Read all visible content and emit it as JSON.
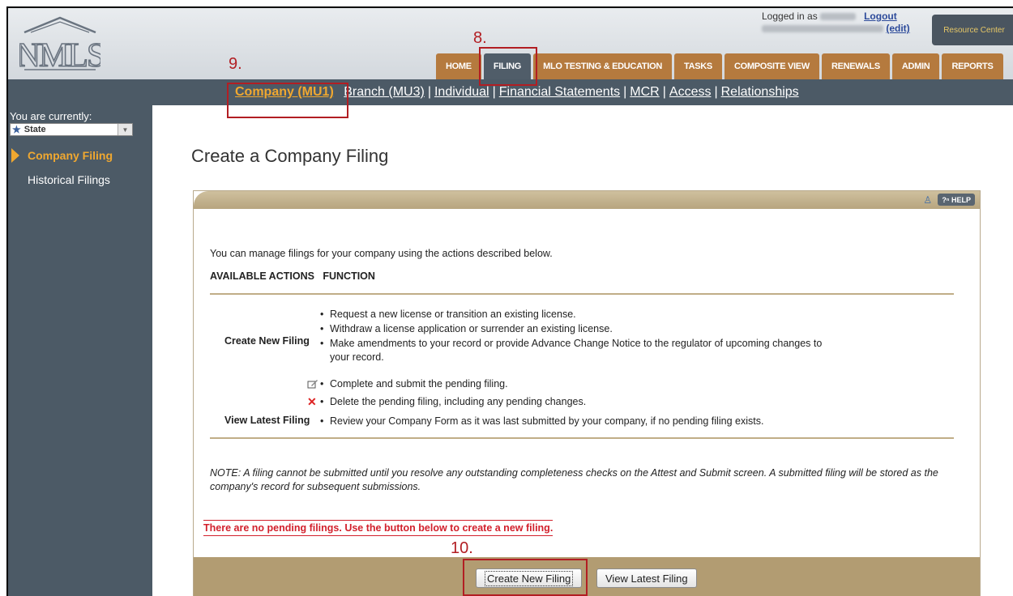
{
  "header": {
    "logo_text": "NMLS",
    "logged_in_label": "Logged in as",
    "logout_label": "Logout",
    "edit_label": "(edit)",
    "resource_center_label": "Resource Center"
  },
  "tabs": [
    {
      "label": "HOME"
    },
    {
      "label": "FILING"
    },
    {
      "label": "MLO TESTING & EDUCATION"
    },
    {
      "label": "TASKS"
    },
    {
      "label": "COMPOSITE VIEW"
    },
    {
      "label": "RENEWALS"
    },
    {
      "label": "ADMIN"
    },
    {
      "label": "REPORTS"
    }
  ],
  "subnav": [
    {
      "label": "Company (MU1)"
    },
    {
      "label": "Branch (MU3)"
    },
    {
      "label": "Individual"
    },
    {
      "label": "Financial Statements"
    },
    {
      "label": "MCR"
    },
    {
      "label": "Access"
    },
    {
      "label": "Relationships"
    }
  ],
  "annotations": {
    "step8": "8.",
    "step9": "9.",
    "step10": "10."
  },
  "sidebar": {
    "context_label": "You are currently:",
    "state_value": "State",
    "items": [
      {
        "label": "Company Filing"
      },
      {
        "label": "Historical Filings"
      }
    ]
  },
  "main": {
    "title": "Create a Company Filing",
    "help_label": "HELP",
    "intro": "You can manage filings for your company using the actions described below.",
    "col_actions": "AVAILABLE ACTIONS",
    "col_function": "FUNCTION",
    "create_label": "Create New Filing",
    "create_bullets": [
      "Request a new license or transition an existing license.",
      "Withdraw a license application or surrender an existing license.",
      "Make amendments to your record or provide Advance Change Notice to the regulator of upcoming changes to"
    ],
    "create_bullet_cont": "your record.",
    "edit_bullet": "Complete and submit the pending filing.",
    "delete_bullet": "Delete the pending filing, including any pending changes.",
    "view_label": "View Latest Filing",
    "view_bullet": "Review your Company Form as it was last submitted by your company, if no pending filing exists.",
    "note": "NOTE: A filing cannot be submitted until you resolve any outstanding completeness checks on the Attest and Submit screen. A submitted filing will be stored as the company's record for subsequent submissions.",
    "pending_message": "There are no pending filings. Use the button below to create a new filing.",
    "create_button": "Create New Filing",
    "view_button": "View Latest Filing"
  }
}
